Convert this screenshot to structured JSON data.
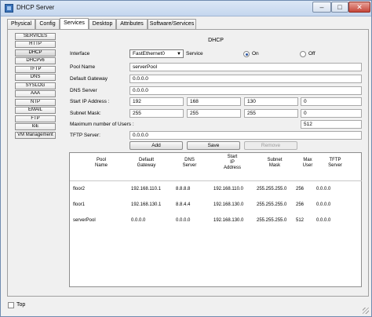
{
  "window": {
    "title": "DHCP Server",
    "minimize": "–",
    "maximize": "□",
    "close": "✕"
  },
  "tabs": [
    {
      "label": "Physical"
    },
    {
      "label": "Config"
    },
    {
      "label": "Services"
    },
    {
      "label": "Desktop"
    },
    {
      "label": "Attributes"
    },
    {
      "label": "Software/Services"
    }
  ],
  "sidebar": {
    "items": [
      {
        "label": "SERVICES"
      },
      {
        "label": "HTTP"
      },
      {
        "label": "DHCP"
      },
      {
        "label": "DHCPv6"
      },
      {
        "label": "TFTP"
      },
      {
        "label": "DNS"
      },
      {
        "label": "SYSLOG"
      },
      {
        "label": "AAA"
      },
      {
        "label": "NTP"
      },
      {
        "label": "EMAIL"
      },
      {
        "label": "FTP"
      },
      {
        "label": "IoE"
      },
      {
        "label": "VM Management"
      }
    ]
  },
  "dhcp": {
    "header": "DHCP",
    "interface_label": "Interface",
    "interface_value": "FastEthernet0",
    "service_label": "Service",
    "on_label": "On",
    "off_label": "Off",
    "pool_name_label": "Pool Name",
    "pool_name_value": "serverPool",
    "default_gateway_label": "Default Gateway",
    "default_gateway_value": "0.0.0.0",
    "dns_server_label": "DNS Server",
    "dns_server_value": "0.0.0.0",
    "start_ip_label": "Start IP Address :",
    "start_ip": [
      "192",
      "168",
      "130",
      "0"
    ],
    "subnet_mask_label": "Subnet Mask:",
    "subnet_mask": [
      "255",
      "255",
      "255",
      "0"
    ],
    "max_users_label": "Maximum number of Users :",
    "max_users_value": "512",
    "tftp_server_label": "TFTP Server:",
    "tftp_server_value": "0.0.0.0",
    "add_label": "Add",
    "save_label": "Save",
    "remove_label": "Remove"
  },
  "pool_table": {
    "headers": {
      "pool_name": "Pool\nName",
      "default_gateway": "Default\nGateway",
      "dns_server": "DNS\nServer",
      "start_ip": "Start\nIP\nAddress",
      "subnet_mask": "Subnet\nMask",
      "max_user": "Max\nUser",
      "tftp_server": "TFTP\nServer"
    },
    "rows": [
      {
        "pool_name": "floor2",
        "gateway": "192.168.110.1",
        "dns": "8.8.8.8",
        "start_ip": "192.168.110.0",
        "mask": "255.255.255.0",
        "max_user": "256",
        "tftp": "0.0.0.0"
      },
      {
        "pool_name": "floor1",
        "gateway": "192.168.130.1",
        "dns": "8.8.4.4",
        "start_ip": "192.168.130.0",
        "mask": "255.255.255.0",
        "max_user": "256",
        "tftp": "0.0.0.0"
      },
      {
        "pool_name": "serverPool",
        "gateway": "0.0.0.0",
        "dns": "0.0.0.0",
        "start_ip": "192.168.130.0",
        "mask": "255.255.255.0",
        "max_user": "512",
        "tftp": "0.0.0.0"
      }
    ]
  },
  "footer": {
    "top_label": "Top"
  }
}
